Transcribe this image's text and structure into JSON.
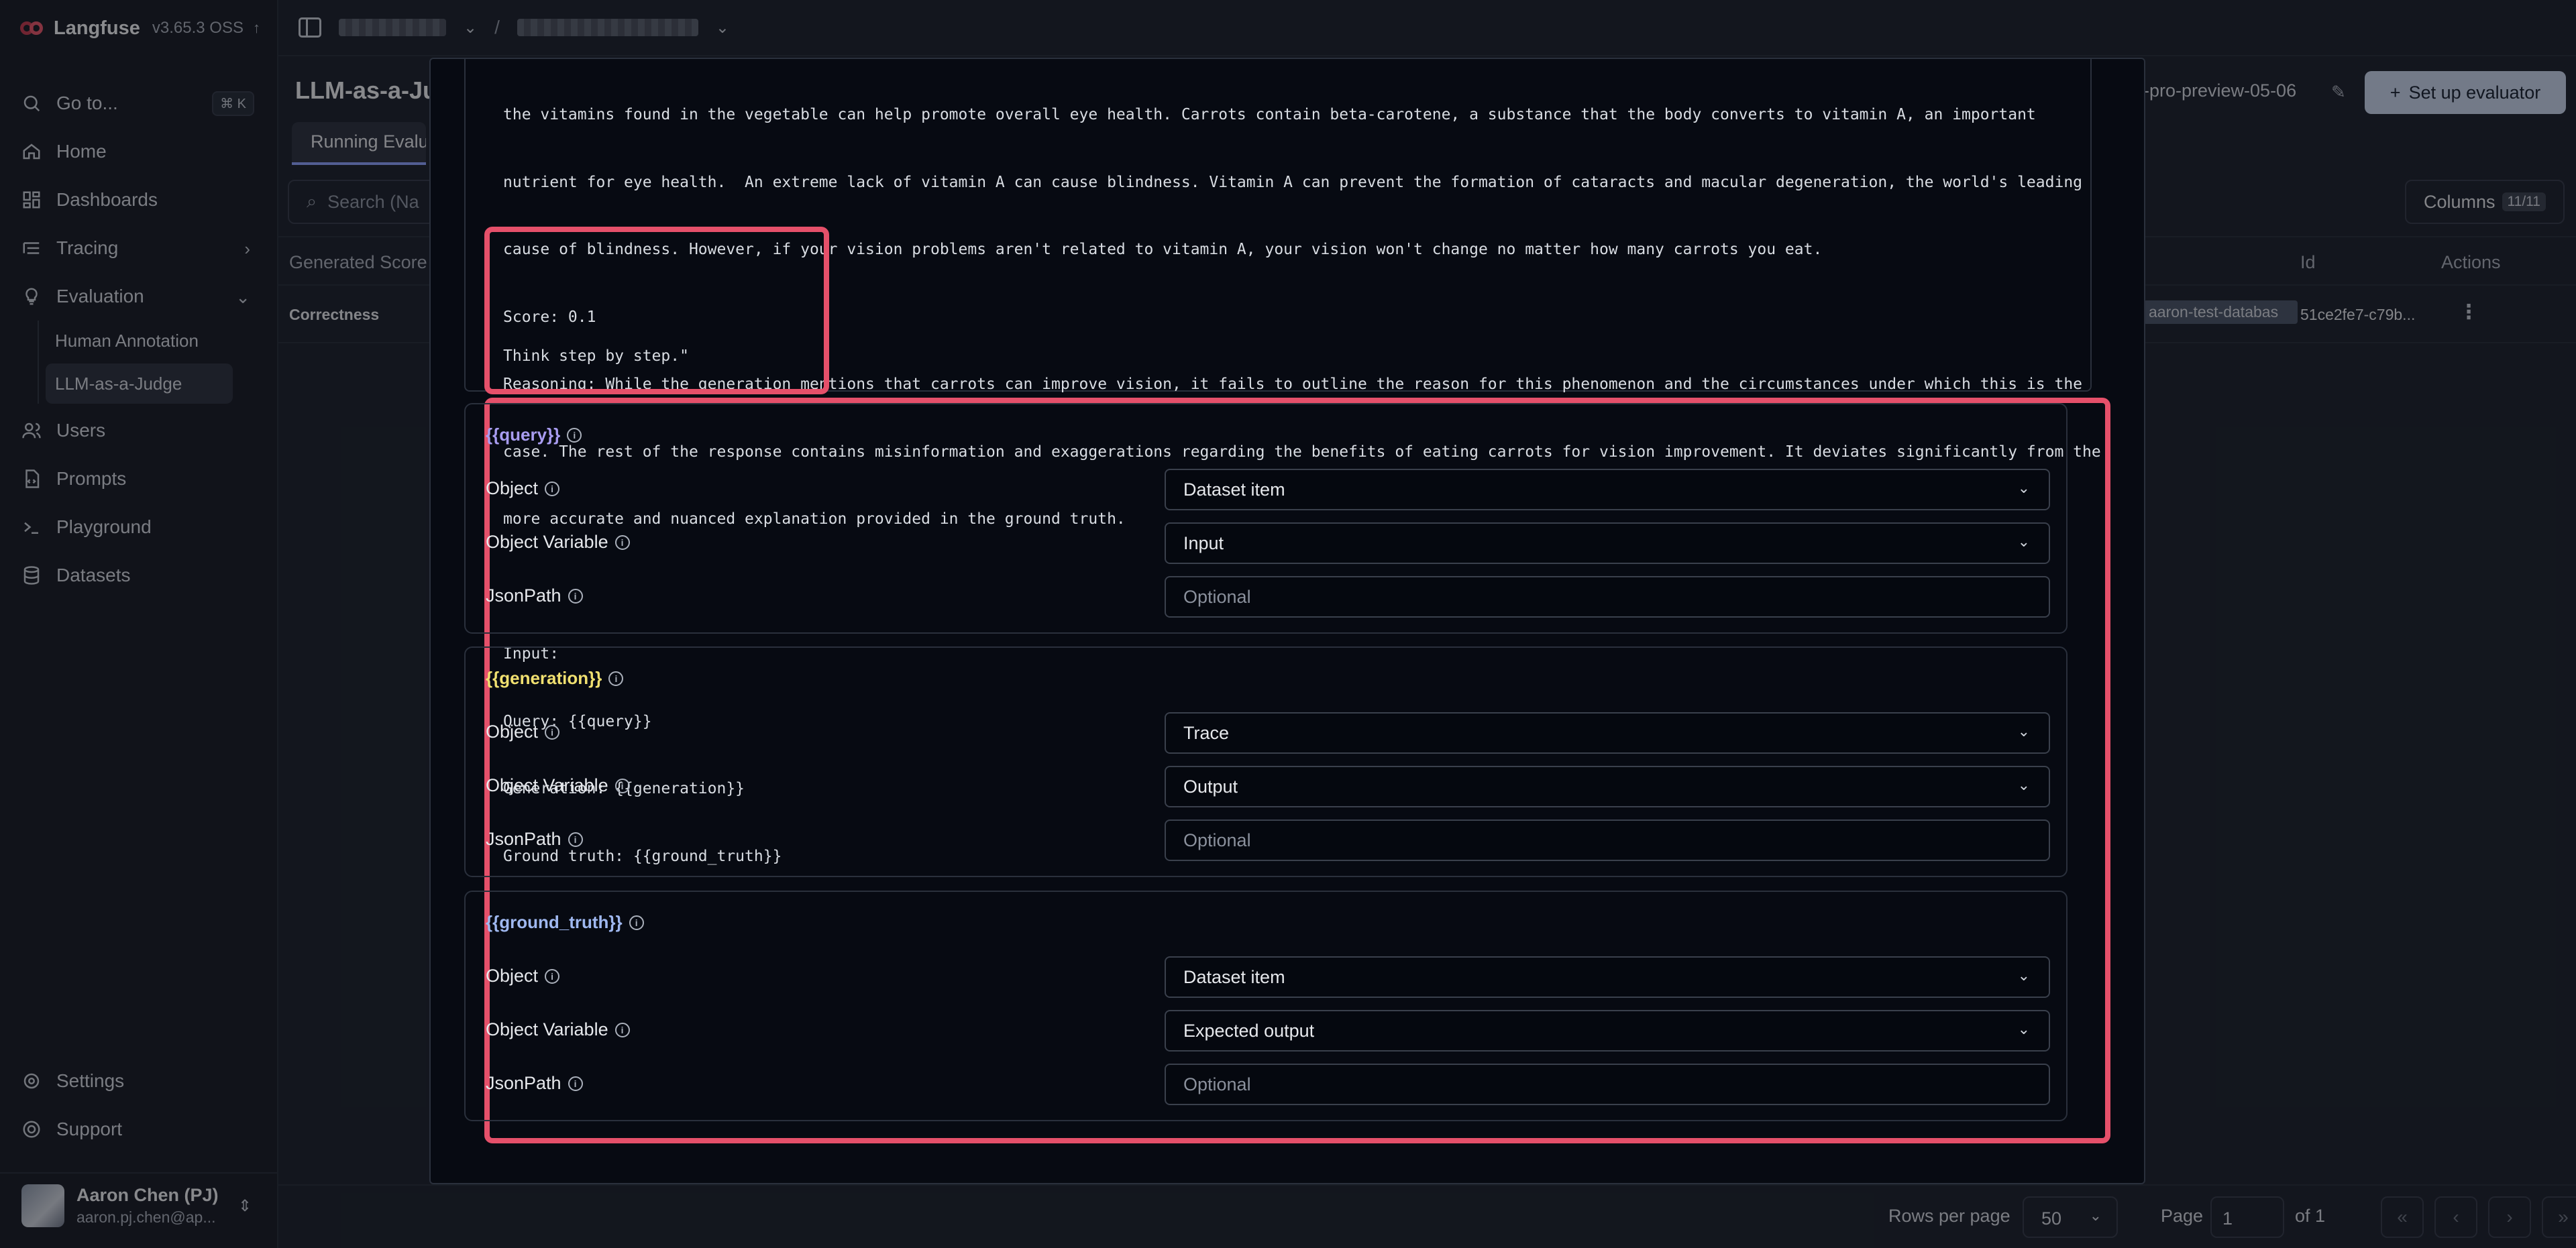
{
  "app": {
    "name": "Langfuse",
    "version": "v3.65.3 OSS"
  },
  "sidebar": {
    "goto": {
      "label": "Go to...",
      "shortcut": "⌘ K"
    },
    "items": [
      {
        "label": "Home"
      },
      {
        "label": "Dashboards"
      },
      {
        "label": "Tracing"
      },
      {
        "label": "Evaluation"
      }
    ],
    "sub_items": [
      {
        "label": "Human Annotation"
      },
      {
        "label": "LLM-as-a-Judge"
      }
    ],
    "items2": [
      {
        "label": "Users"
      },
      {
        "label": "Prompts"
      },
      {
        "label": "Playground"
      },
      {
        "label": "Datasets"
      }
    ],
    "bottom": [
      {
        "label": "Settings"
      },
      {
        "label": "Support"
      }
    ],
    "user": {
      "name": "Aaron Chen (PJ)",
      "email": "aaron.pj.chen@ap..."
    }
  },
  "page": {
    "title": "LLM-as-a-Ju",
    "tab_running": "Running Evalua",
    "model": "-pro-preview-05-06",
    "setup_button": "Set up evaluator",
    "search_placeholder": "Search (Na",
    "columns_label": "Columns",
    "columns_count": "11/11",
    "table": {
      "headers": {
        "generated_score": "Generated Score",
        "id": "Id",
        "actions": "Actions"
      },
      "row": {
        "name": "Correctness",
        "dataset": "aaron-test-databas",
        "id": "51ce2fe7-c79b..."
      }
    },
    "footer": {
      "rows_per_page_label": "Rows per page",
      "rows_per_page": "50",
      "page_label": "Page",
      "page": "1",
      "of": "of 1"
    }
  },
  "modal": {
    "prompt_lines": [
      "the vitamins found in the vegetable can help promote overall eye health. Carrots contain beta-carotene, a substance that the body converts to vitamin A, an important",
      "nutrient for eye health.  An extreme lack of vitamin A can cause blindness. Vitamin A can prevent the formation of cataracts and macular degeneration, the world's leading",
      "cause of blindness. However, if your vision problems aren't related to vitamin A, your vision won't change no matter how many carrots you eat.",
      "Score: 0.1",
      "Reasoning: While the generation mentions that carrots can improve vision, it fails to outline the reason for this phenomenon and the circumstances under which this is the",
      "case. The rest of the response contains misinformation and exaggerations regarding the benefits of eating carrots for vision improvement. It deviates significantly from the",
      "more accurate and nuanced explanation provided in the ground truth.",
      "",
      "Input:",
      "Query: {{query}}",
      "Generation: {{generation}}",
      "Ground truth: {{ground_truth}}"
    ],
    "prompt_tail": "Think step by step.\"",
    "variables": [
      {
        "name": "{{query}}",
        "color": "#a89cf0",
        "object_label": "Object",
        "object_value": "Dataset item",
        "variable_label": "Object Variable",
        "variable_value": "Input",
        "jsonpath_label": "JsonPath",
        "jsonpath_placeholder": "Optional"
      },
      {
        "name": "{{generation}}",
        "color": "#f0e070",
        "object_label": "Object",
        "object_value": "Trace",
        "variable_label": "Object Variable",
        "variable_value": "Output",
        "jsonpath_label": "JsonPath",
        "jsonpath_placeholder": "Optional"
      },
      {
        "name": "{{ground_truth}}",
        "color": "#9fb8f0",
        "object_label": "Object",
        "object_value": "Dataset item",
        "variable_label": "Object Variable",
        "variable_value": "Expected output",
        "jsonpath_label": "JsonPath",
        "jsonpath_placeholder": "Optional"
      }
    ]
  },
  "colors": {
    "highlight": "#e5506a",
    "accent": "#8da2ff"
  }
}
